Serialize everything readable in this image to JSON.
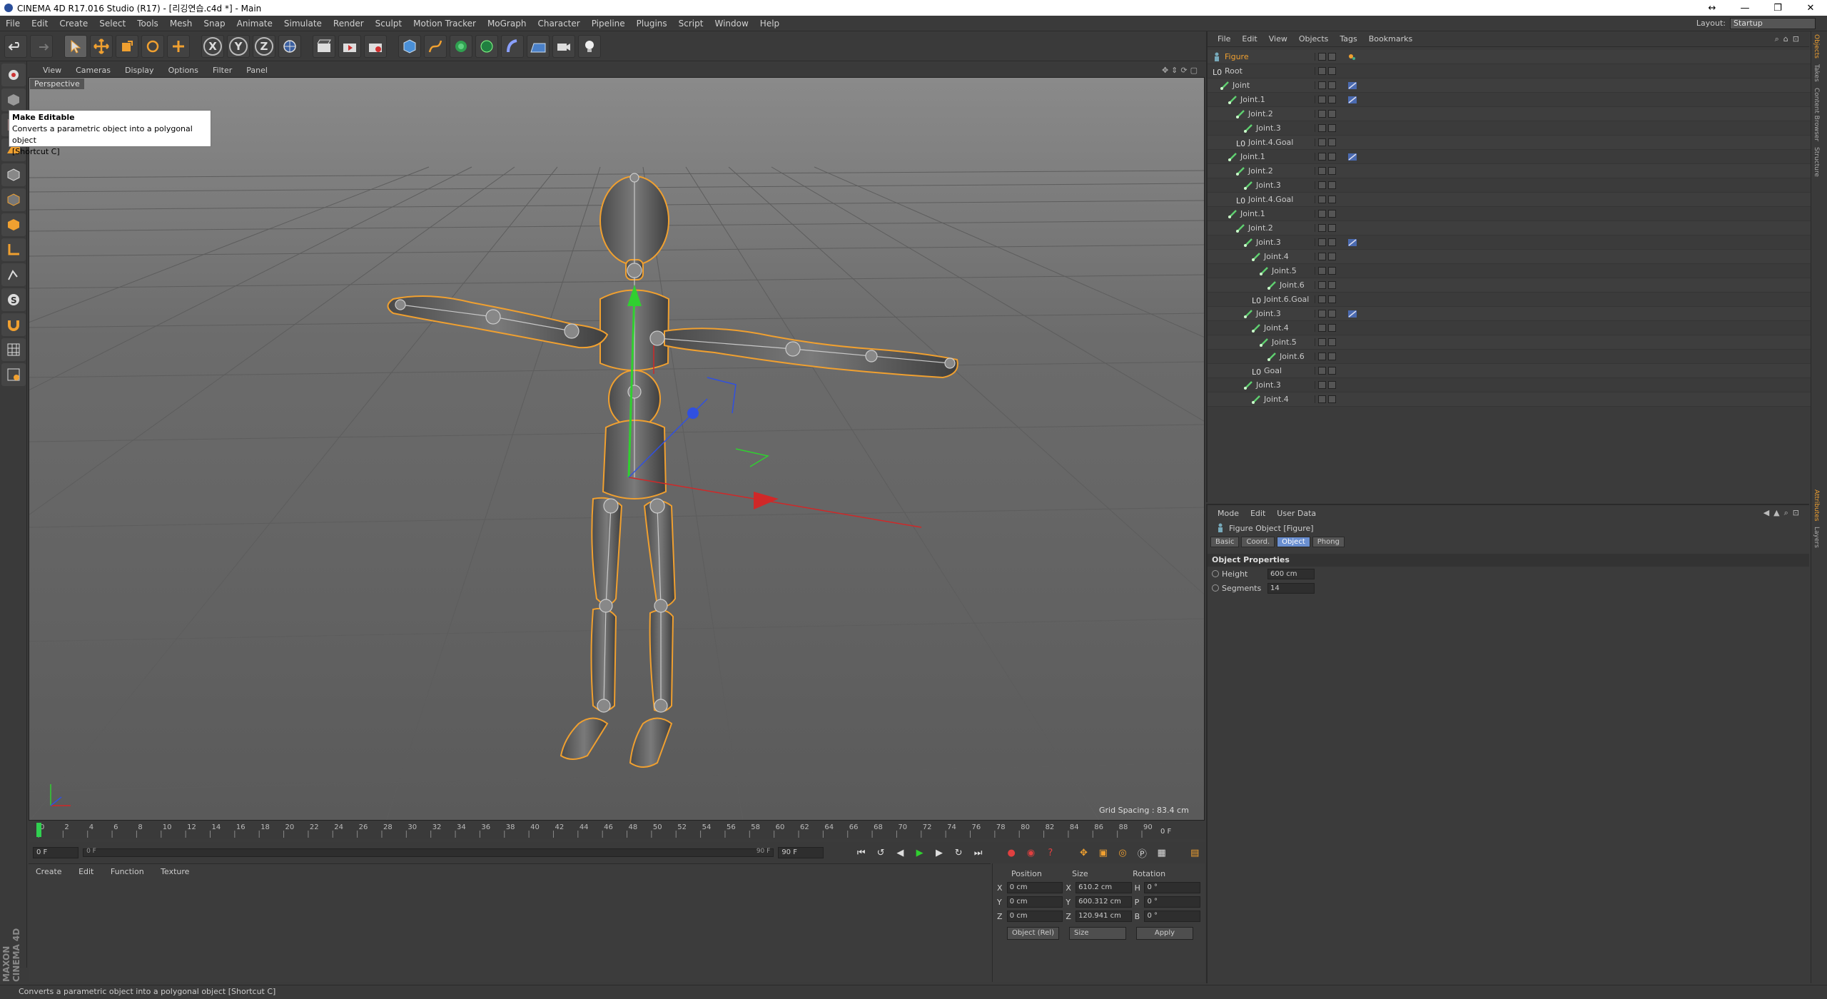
{
  "window": {
    "title": "CINEMA 4D R17.016 Studio (R17) - [리깅연습.c4d *] - Main",
    "controls": [
      "↔",
      "—",
      "❐",
      "✕"
    ]
  },
  "menu": [
    "File",
    "Edit",
    "Create",
    "Select",
    "Tools",
    "Mesh",
    "Snap",
    "Animate",
    "Simulate",
    "Render",
    "Sculpt",
    "Motion Tracker",
    "MoGraph",
    "Character",
    "Pipeline",
    "Plugins",
    "Script",
    "Window",
    "Help"
  ],
  "layout": {
    "label": "Layout:",
    "value": "Startup"
  },
  "toolbar": {
    "axes": [
      "X",
      "Y",
      "Z"
    ]
  },
  "tooltip": {
    "title": "Make Editable",
    "desc": "Converts a parametric object into a polygonal object",
    "shortcut": "[Shortcut C]"
  },
  "viewport": {
    "menu": [
      "View",
      "Cameras",
      "Display",
      "Options",
      "Filter",
      "Panel"
    ],
    "label": "Perspective",
    "grid_spacing": "Grid Spacing : 83.4 cm"
  },
  "timeline": {
    "ticks": [
      "0",
      "2",
      "4",
      "6",
      "8",
      "10",
      "12",
      "14",
      "16",
      "18",
      "20",
      "22",
      "24",
      "26",
      "28",
      "30",
      "32",
      "34",
      "36",
      "38",
      "40",
      "42",
      "44",
      "46",
      "48",
      "50",
      "52",
      "54",
      "56",
      "58",
      "60",
      "62",
      "64",
      "66",
      "68",
      "70",
      "72",
      "74",
      "76",
      "78",
      "80",
      "82",
      "84",
      "86",
      "88",
      "90"
    ],
    "current_frame": "0 F",
    "start_field": "0 F",
    "range_start": "0 F",
    "range_end": "90 F",
    "end_field": "90 F"
  },
  "material_manager": {
    "menu": [
      "Create",
      "Edit",
      "Function",
      "Texture"
    ]
  },
  "coords": {
    "headers": [
      "Position",
      "Size",
      "Rotation"
    ],
    "rows": [
      {
        "axis": "X",
        "pos": "0 cm",
        "size_axis": "X",
        "size": "610.2 cm",
        "rot_axis": "H",
        "rot": "0 °"
      },
      {
        "axis": "Y",
        "pos": "0 cm",
        "size_axis": "Y",
        "size": "600.312 cm",
        "rot_axis": "P",
        "rot": "0 °"
      },
      {
        "axis": "Z",
        "pos": "0 cm",
        "size_axis": "Z",
        "size": "120.941 cm",
        "rot_axis": "B",
        "rot": "0 °"
      }
    ],
    "mode1": "Object (Rel)",
    "mode2": "Size",
    "apply": "Apply"
  },
  "status": "Converts a parametric object into a polygonal object [Shortcut C]",
  "branding": "MAXON CINEMA 4D",
  "object_manager": {
    "menu": [
      "File",
      "Edit",
      "View",
      "Objects",
      "Tags",
      "Bookmarks"
    ],
    "objects": [
      {
        "name": "Figure",
        "indent": 0,
        "selected": true,
        "tag": "figure"
      },
      {
        "name": "Root",
        "indent": 0,
        "selected": false,
        "tag": ""
      },
      {
        "name": "Joint",
        "indent": 1,
        "selected": false,
        "tag": "ik"
      },
      {
        "name": "Joint.1",
        "indent": 2,
        "selected": false,
        "tag": "ik"
      },
      {
        "name": "Joint.2",
        "indent": 3,
        "selected": false,
        "tag": ""
      },
      {
        "name": "Joint.3",
        "indent": 4,
        "selected": false,
        "tag": ""
      },
      {
        "name": "Joint.4.Goal",
        "indent": 3,
        "selected": false,
        "tag": ""
      },
      {
        "name": "Joint.1",
        "indent": 2,
        "selected": false,
        "tag": "ik"
      },
      {
        "name": "Joint.2",
        "indent": 3,
        "selected": false,
        "tag": ""
      },
      {
        "name": "Joint.3",
        "indent": 4,
        "selected": false,
        "tag": ""
      },
      {
        "name": "Joint.4.Goal",
        "indent": 3,
        "selected": false,
        "tag": ""
      },
      {
        "name": "Joint.1",
        "indent": 2,
        "selected": false,
        "tag": ""
      },
      {
        "name": "Joint.2",
        "indent": 3,
        "selected": false,
        "tag": ""
      },
      {
        "name": "Joint.3",
        "indent": 4,
        "selected": false,
        "tag": "ik"
      },
      {
        "name": "Joint.4",
        "indent": 5,
        "selected": false,
        "tag": ""
      },
      {
        "name": "Joint.5",
        "indent": 6,
        "selected": false,
        "tag": ""
      },
      {
        "name": "Joint.6",
        "indent": 7,
        "selected": false,
        "tag": ""
      },
      {
        "name": "Joint.6.Goal",
        "indent": 5,
        "selected": false,
        "tag": ""
      },
      {
        "name": "Joint.3",
        "indent": 4,
        "selected": false,
        "tag": "ik"
      },
      {
        "name": "Joint.4",
        "indent": 5,
        "selected": false,
        "tag": ""
      },
      {
        "name": "Joint.5",
        "indent": 6,
        "selected": false,
        "tag": ""
      },
      {
        "name": "Joint.6",
        "indent": 7,
        "selected": false,
        "tag": ""
      },
      {
        "name": "Goal",
        "indent": 5,
        "selected": false,
        "tag": ""
      },
      {
        "name": "Joint.3",
        "indent": 4,
        "selected": false,
        "tag": ""
      },
      {
        "name": "Joint.4",
        "indent": 5,
        "selected": false,
        "tag": ""
      }
    ]
  },
  "attributes": {
    "menu": [
      "Mode",
      "Edit",
      "User Data"
    ],
    "header": "Figure Object [Figure]",
    "tabs": [
      {
        "label": "Basic",
        "active": false
      },
      {
        "label": "Coord.",
        "active": false
      },
      {
        "label": "Object",
        "active": true
      },
      {
        "label": "Phong",
        "active": false
      }
    ],
    "section": "Object Properties",
    "props": [
      {
        "label": "Height",
        "value": "600 cm"
      },
      {
        "label": "Segments",
        "value": "14"
      }
    ]
  },
  "right_tabs": [
    {
      "label": "Objects",
      "active": true
    },
    {
      "label": "Takes",
      "active": false
    },
    {
      "label": "Content Browser",
      "active": false
    },
    {
      "label": "Structure",
      "active": false
    },
    {
      "label": "Attributes",
      "active": true
    },
    {
      "label": "Layers",
      "active": false
    }
  ]
}
